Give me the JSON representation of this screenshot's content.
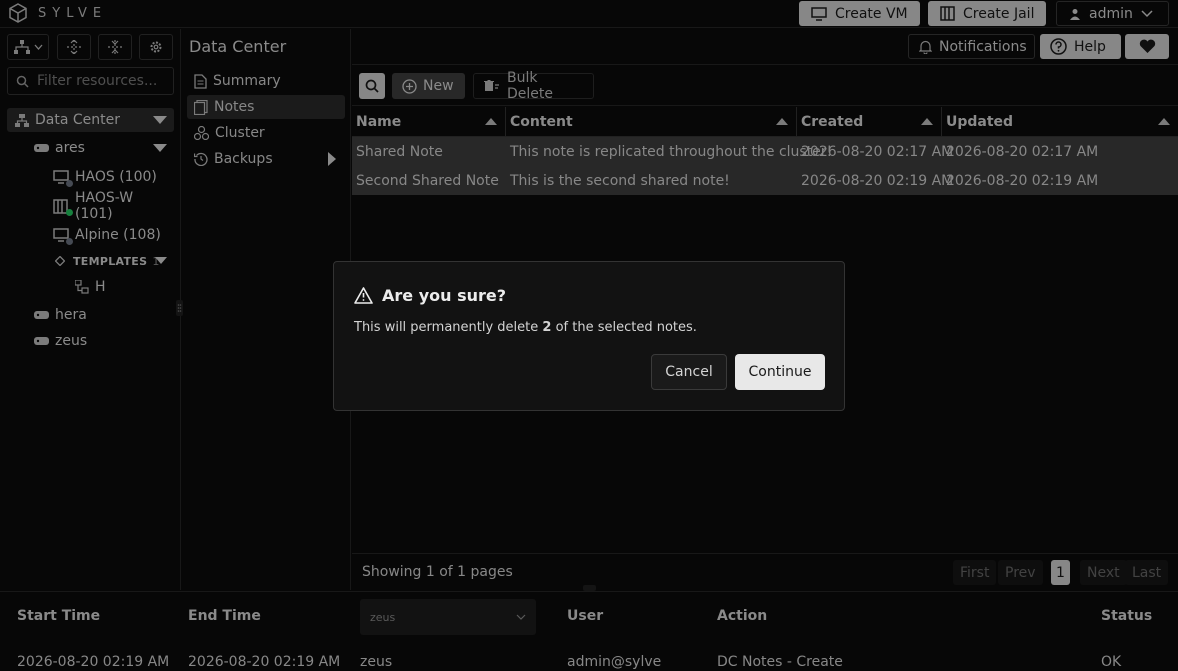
{
  "app": {
    "brand": "SYLVE"
  },
  "topbar": {
    "create_vm": "Create VM",
    "create_jail": "Create Jail",
    "user": "admin"
  },
  "header": {
    "title": "Data Center",
    "notifications": "Notifications",
    "help": "Help"
  },
  "sidebar": {
    "filter_placeholder": "Filter resources...",
    "tree": {
      "root": "Data Center",
      "nodes": [
        {
          "name": "ares",
          "children": [
            {
              "name": "HAOS (100)",
              "status": "grey"
            },
            {
              "name": "HAOS-W (101)",
              "status": "green"
            },
            {
              "name": "Alpine (108)",
              "status": "grey"
            }
          ],
          "templates_label": "TEMPLATES",
          "templates_count": "1",
          "template_item": "H"
        },
        {
          "name": "hera"
        },
        {
          "name": "zeus"
        }
      ]
    }
  },
  "nav": {
    "items": [
      "Summary",
      "Notes",
      "Cluster",
      "Backups"
    ]
  },
  "toolbar": {
    "new": "New",
    "bulk_delete": "Bulk Delete"
  },
  "table": {
    "columns": [
      "Name",
      "Content",
      "Created",
      "Updated"
    ],
    "rows": [
      {
        "name": "Shared Note",
        "content": "This note is replicated throughout the cluster!",
        "created": "2026-08-20 02:17 AM",
        "updated": "2026-08-20 02:17 AM"
      },
      {
        "name": "Second Shared Note",
        "content": "This is the second shared note!",
        "created": "2026-08-20 02:19 AM",
        "updated": "2026-08-20 02:19 AM"
      }
    ]
  },
  "pagination": {
    "text": "Showing 1 of 1 pages",
    "first": "First",
    "prev": "Prev",
    "page": "1",
    "next": "Next",
    "last": "Last"
  },
  "tasks": {
    "columns": [
      "Start Time",
      "End Time",
      "User",
      "Action",
      "Status"
    ],
    "node_select": "zeus",
    "row": {
      "start": "2026-08-20 02:19 AM",
      "end": "2026-08-20 02:19 AM",
      "node": "zeus",
      "user": "admin@sylve",
      "action": "DC Notes - Create",
      "status": "OK"
    }
  },
  "dialog": {
    "title": "Are you sure?",
    "text_before": "This will permanently delete ",
    "count": "2",
    "text_after": " of the selected notes.",
    "cancel": "Cancel",
    "continue": "Continue"
  },
  "colors": {
    "accent": "#cfcfcf",
    "status_green": "#22c55e",
    "status_grey": "#6b7280",
    "selected_row": "#3e3e3e"
  }
}
